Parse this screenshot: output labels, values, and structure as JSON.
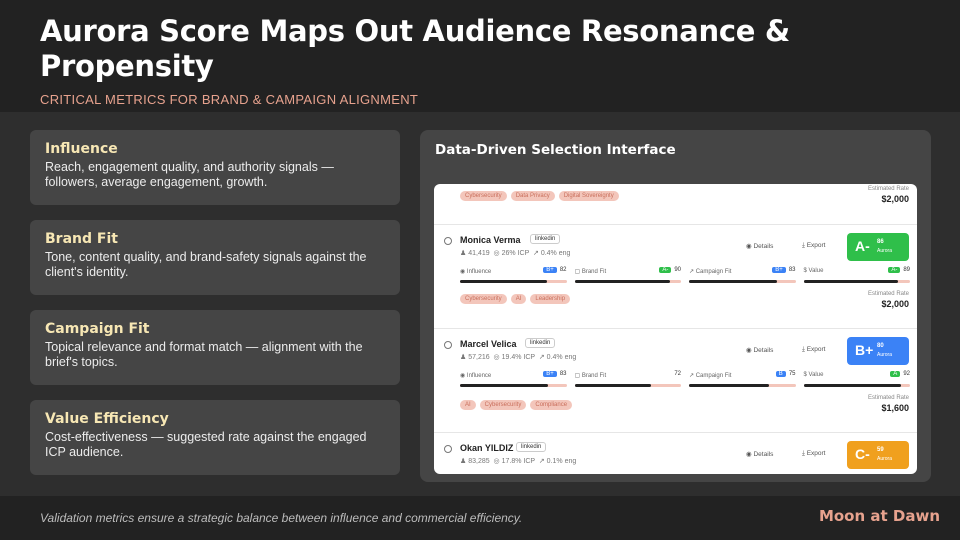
{
  "header": {
    "title": "Aurora Score Maps Out Audience Resonance & Propensity",
    "subtitle": "CRITICAL METRICS FOR BRAND & CAMPAIGN ALIGNMENT"
  },
  "cards": [
    {
      "title": "Influence",
      "text": "Reach, engagement quality, and authority signals — followers, average engagement, growth."
    },
    {
      "title": "Brand Fit",
      "text": "Tone, content quality, and brand-safety signals against the client's identity."
    },
    {
      "title": "Campaign Fit",
      "text": "Topical relevance and format match — alignment with the brief's topics."
    },
    {
      "title": "Value Efficiency",
      "text": "Cost-effectiveness — suggested rate against the engaged ICP audience."
    }
  ],
  "panel": {
    "title": "Data-Driven Selection Interface",
    "top": {
      "tags": [
        "Cybersecurity",
        "Data Privacy",
        "Digital Sovereignty"
      ],
      "rate_label": "Estimated Rate",
      "rate_value": "$2,000"
    },
    "influencers": [
      {
        "name": "Monica Verma",
        "platform": "linkedin",
        "followers": "41,419",
        "icp": "26% ICP",
        "eng": "0.4% eng",
        "details": "Details",
        "export": "Export",
        "grade": "A-",
        "score": "86",
        "score_label": "Aurora",
        "grade_color": "#2fbf4a",
        "metrics": [
          {
            "label": "Influence",
            "chip": "B+",
            "chip_color": "#3b82f6",
            "value": "82",
            "fraction": 0.82
          },
          {
            "label": "Brand Fit",
            "chip": "A-",
            "chip_color": "#2fbf4a",
            "value": "90",
            "fraction": 0.9
          },
          {
            "label": "Campaign Fit",
            "chip": "B+",
            "chip_color": "#3b82f6",
            "value": "83",
            "fraction": 0.83
          },
          {
            "label": "Value",
            "chip": "A-",
            "chip_color": "#2fbf4a",
            "value": "89",
            "fraction": 0.89
          }
        ],
        "tags": [
          "Cybersecurity",
          "AI",
          "Leadership"
        ],
        "rate_label": "Estimated Rate",
        "rate_value": "$2,000"
      },
      {
        "name": "Marcel Velica",
        "platform": "linkedin",
        "followers": "57,216",
        "icp": "19.4% ICP",
        "eng": "0.4% eng",
        "details": "Details",
        "export": "Export",
        "grade": "B+",
        "score": "80",
        "score_label": "Aurora",
        "grade_color": "#3b82f6",
        "metrics": [
          {
            "label": "Influence",
            "chip": "B+",
            "chip_color": "#3b82f6",
            "value": "83",
            "fraction": 0.83
          },
          {
            "label": "Brand Fit",
            "chip": "",
            "chip_color": "",
            "value": "72",
            "fraction": 0.72
          },
          {
            "label": "Campaign Fit",
            "chip": "B",
            "chip_color": "#3b82f6",
            "value": "75",
            "fraction": 0.75
          },
          {
            "label": "Value",
            "chip": "A",
            "chip_color": "#2fbf4a",
            "value": "92",
            "fraction": 0.92
          }
        ],
        "tags": [
          "AI",
          "Cybersecurity",
          "Compliance"
        ],
        "rate_label": "Estimated Rate",
        "rate_value": "$1,600"
      },
      {
        "name": "Okan YILDIZ",
        "platform": "linkedin",
        "followers": "83,285",
        "icp": "17.8% ICP",
        "eng": "0.1% eng",
        "details": "Details",
        "export": "Export",
        "grade": "C-",
        "score": "59",
        "score_label": "Aurora",
        "grade_color": "#f0a01e",
        "metrics": [],
        "tags": [],
        "rate_label": "",
        "rate_value": ""
      }
    ]
  },
  "footer": {
    "note": "Validation metrics ensure a strategic balance between influence and commercial efficiency.",
    "brand": "Moon at Dawn"
  }
}
